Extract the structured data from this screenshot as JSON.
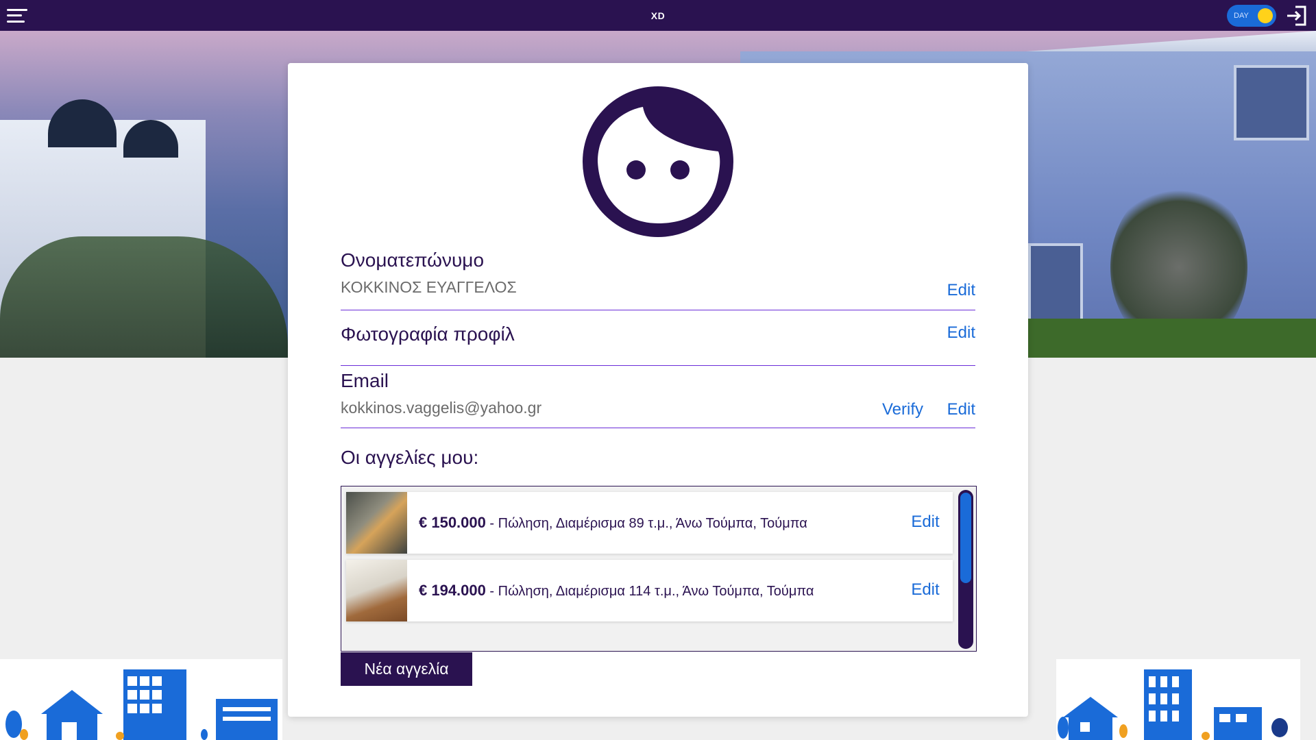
{
  "topbar": {
    "brand": "XD",
    "theme_toggle_label": "DAY"
  },
  "profile": {
    "name_label": "Ονοματεπώνυμο",
    "name_value": "ΚΟΚΚΙΝΟΣ ΕΥΑΓΓΕΛΟΣ",
    "photo_label": "Φωτογραφία προφίλ",
    "email_label": "Email",
    "email_value": "kokkinos.vaggelis@yahoo.gr",
    "edit_label": "Edit",
    "verify_label": "Verify"
  },
  "listings": {
    "title": "Οι αγγελίες μου:",
    "items": [
      {
        "price": "€ 150.000",
        "description": " - Πώληση, Διαμέρισμα 89 τ.μ., Άνω Τούμπα, Τούμπα",
        "edit": "Edit"
      },
      {
        "price": "€ 194.000",
        "description": " - Πώληση, Διαμέρισμα 114 τ.μ., Άνω Τούμπα, Τούμπα",
        "edit": "Edit"
      }
    ],
    "new_button": "Νέα αγγελία"
  },
  "colors": {
    "primary": "#2a1250",
    "accent": "#1a6bd8",
    "divider": "#6a2bd8",
    "toggle_knob": "#ffd21a"
  }
}
